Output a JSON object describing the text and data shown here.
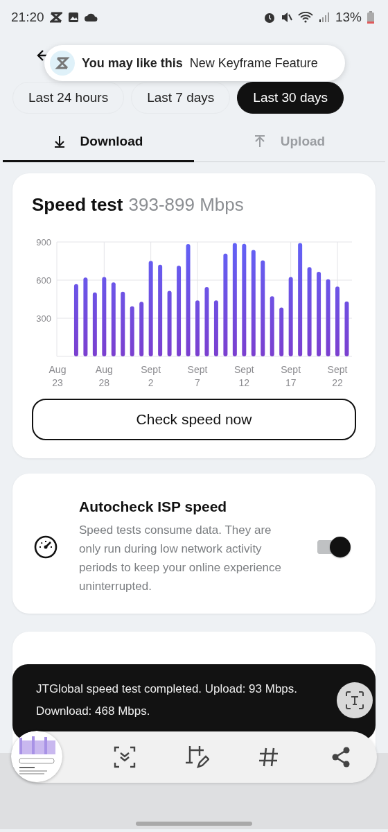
{
  "status_bar": {
    "time": "21:20",
    "battery": "13%"
  },
  "notification": {
    "title": "You may like this",
    "text": "New Keyframe Feature"
  },
  "periods": [
    {
      "label": "Last 24 hours",
      "selected": false
    },
    {
      "label": "Last 7 days",
      "selected": false
    },
    {
      "label": "Last 30 days",
      "selected": true
    }
  ],
  "tabs": [
    {
      "label": "Download",
      "kind": "download",
      "selected": true
    },
    {
      "label": "Upload",
      "kind": "upload",
      "selected": false
    }
  ],
  "speed_card": {
    "title": "Speed test",
    "range": "393-899 Mbps",
    "button": "Check speed now",
    "chart_data": {
      "type": "bar",
      "categories": [
        "Aug 23",
        null,
        null,
        null,
        null,
        "Aug 28",
        null,
        null,
        null,
        null,
        "Sept 2",
        null,
        null,
        null,
        null,
        "Sept 7",
        null,
        null,
        null,
        null,
        "Sept 12",
        null,
        null,
        null,
        null,
        "Sept 17",
        null,
        null,
        null,
        null,
        "Sept 22",
        null
      ],
      "series": [
        {
          "color": "#7b3fcf",
          "values": [
            null,
            null,
            569,
            620,
            503,
            624,
            582,
            509,
            394,
            429,
            751,
            722,
            516,
            713,
            883,
            440,
            545,
            440,
            808,
            892,
            885,
            837,
            755,
            473,
            385,
            624,
            892,
            702,
            666,
            607,
            549,
            432
          ]
        }
      ],
      "ylim": [
        0,
        900
      ],
      "grid": true,
      "yticks": [
        300,
        600,
        900
      ]
    }
  },
  "autocheck_card": {
    "title": "Autocheck ISP speed",
    "description": "Speed tests consume data. They are only run during low network activity periods to keep your online experience uninterrupted.",
    "toggle": {
      "on": true
    }
  },
  "toast": {
    "text": "JTGlobal speed test completed. Upload: 93 Mbps. Download: 468 Mbps."
  }
}
